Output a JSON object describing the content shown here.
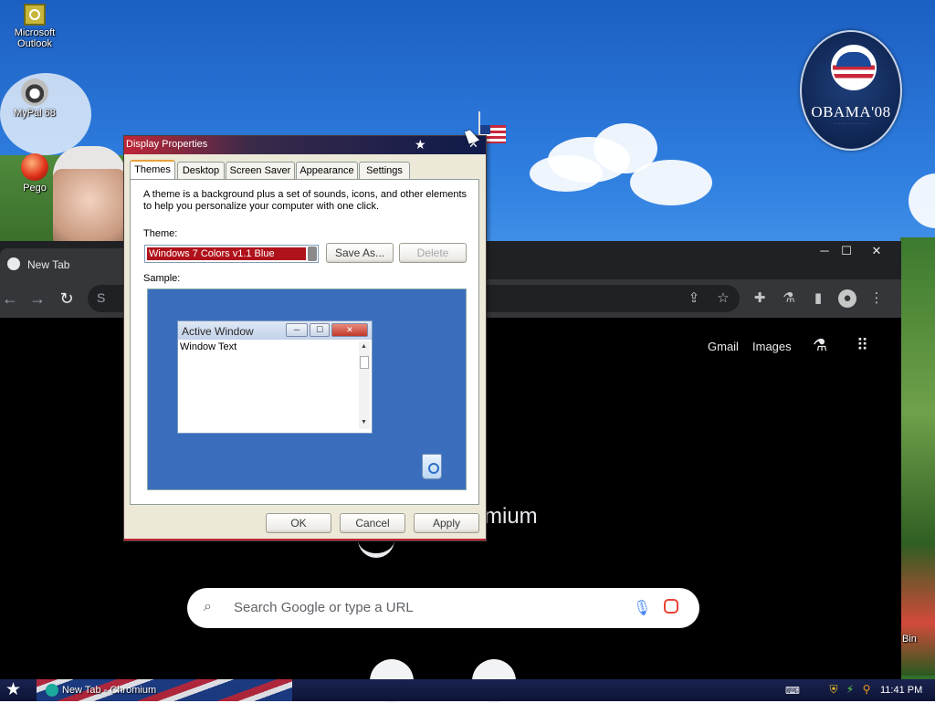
{
  "desktop": {
    "icons": [
      {
        "label_lines": [
          "Microsoft",
          "Outlook"
        ],
        "icon": "outlook-icon"
      },
      {
        "label_lines": [
          "MyPal 68"
        ],
        "icon": "mypal-raccoon-icon"
      },
      {
        "label_lines": [
          "Pego"
        ],
        "icon": "pego-ball-icon"
      }
    ],
    "badge_text": "OBAMA'08",
    "recycle_bin_partial": "Bin"
  },
  "chromium": {
    "tab_title": "New Tab",
    "omnibox_text": "S",
    "window_buttons": {
      "minimize": "─",
      "maximize": "☐",
      "close": "✕"
    },
    "header_links": [
      "Gmail",
      "Images"
    ],
    "brand_partial": "mium",
    "search_placeholder": "Search Google or type a URL"
  },
  "dialog": {
    "title": "Display Properties",
    "tabs": [
      "Themes",
      "Desktop",
      "Screen Saver",
      "Appearance",
      "Settings"
    ],
    "active_tab": "Themes",
    "description": "A theme is a background plus a set of sounds, icons, and other elements to help you personalize your computer with one click.",
    "theme_label": "Theme:",
    "theme_value": "Windows 7 Colors v1.1 Blue",
    "save_as_label": "Save As...",
    "delete_label": "Delete",
    "sample_label": "Sample:",
    "sample_window_title": "Active Window",
    "sample_window_text": "Window Text",
    "ok_label": "OK",
    "cancel_label": "Cancel",
    "apply_label": "Apply"
  },
  "taskbar": {
    "task_label": "New Tab - Chromium",
    "clock": "11:41 PM"
  },
  "colors": {
    "dialog_title_left": "#c02636",
    "dialog_title_right": "#0e1a4a",
    "theme_selected_bg": "#b0121b",
    "chromium_bg": "#000000",
    "sample_bg": "#3a6ebc"
  }
}
